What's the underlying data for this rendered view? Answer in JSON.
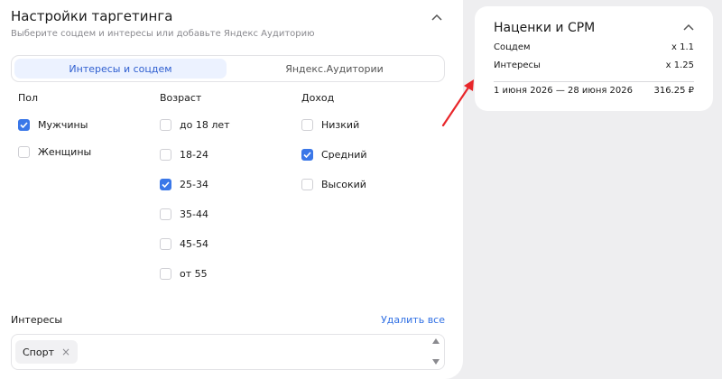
{
  "targeting": {
    "title": "Настройки таргетинга",
    "subtitle": "Выберите соцдем и интересы или добавьте Яндекс Аудиторию",
    "tabs": [
      {
        "label": "Интересы и соцдем",
        "active": true
      },
      {
        "label": "Яндекс.Аудитории",
        "active": false
      }
    ],
    "gender": {
      "title": "Пол",
      "options": [
        {
          "label": "Мужчины",
          "checked": true
        },
        {
          "label": "Женщины",
          "checked": false
        }
      ]
    },
    "age": {
      "title": "Возраст",
      "options": [
        {
          "label": "до 18 лет",
          "checked": false
        },
        {
          "label": "18-24",
          "checked": false
        },
        {
          "label": "25-34",
          "checked": true
        },
        {
          "label": "35-44",
          "checked": false
        },
        {
          "label": "45-54",
          "checked": false
        },
        {
          "label": "от 55",
          "checked": false
        }
      ]
    },
    "income": {
      "title": "Доход",
      "options": [
        {
          "label": "Низкий",
          "checked": false
        },
        {
          "label": "Средний",
          "checked": true
        },
        {
          "label": "Высокий",
          "checked": false
        }
      ]
    },
    "interests": {
      "title": "Интересы",
      "delete_all": "Удалить все",
      "chips": [
        {
          "label": "Спорт"
        }
      ]
    }
  },
  "markup_card": {
    "title": "Наценки и CPM",
    "rows": [
      {
        "label": "Соцдем",
        "value": "x 1.1"
      },
      {
        "label": "Интересы",
        "value": "x 1.25"
      }
    ],
    "period": "1 июня 2026 — 28 июня 2026",
    "total": "316.25 ₽"
  },
  "colors": {
    "accent": "#3a77e8",
    "link": "#2f6fe4",
    "annotation_arrow": "#e8262a",
    "background": "#eeeef0"
  }
}
